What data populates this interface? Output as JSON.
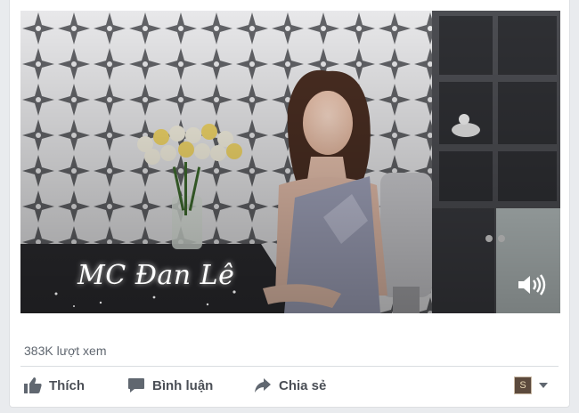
{
  "video": {
    "caption": "MC Đan Lê",
    "volume_icon": "speaker-icon"
  },
  "stats": {
    "views": "383K lượt xem"
  },
  "actions": {
    "like_label": "Thích",
    "comment_label": "Bình luận",
    "share_label": "Chia sẻ",
    "like_icon": "thumbs-up-icon",
    "comment_icon": "comment-icon",
    "share_icon": "share-arrow-icon"
  },
  "audience": {
    "thumb_glyph": "S"
  },
  "colors": {
    "text_secondary": "#606770",
    "action_text": "#4b4f56",
    "card_bg": "#ffffff",
    "page_bg": "#e9ebee"
  }
}
